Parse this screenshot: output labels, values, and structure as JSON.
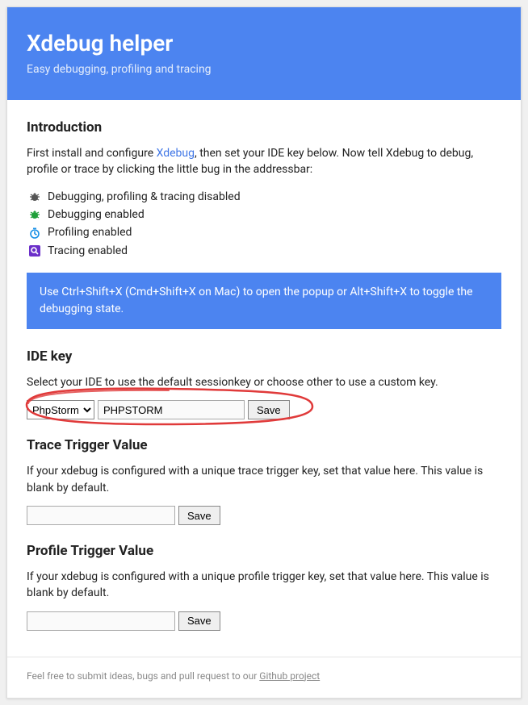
{
  "header": {
    "title": "Xdebug helper",
    "subtitle": "Easy debugging, profiling and tracing"
  },
  "intro": {
    "heading": "Introduction",
    "text_before_link": "First install and configure ",
    "link_text": "Xdebug",
    "text_after_link": ", then set your IDE key below. Now tell Xdebug to debug, profile or trace by clicking the little bug in the addressbar:"
  },
  "status_items": [
    {
      "label": "Debugging, profiling & tracing disabled",
      "icon": "bug-disabled-icon",
      "color": "#555"
    },
    {
      "label": "Debugging enabled",
      "icon": "bug-debug-icon",
      "color": "#1fa03a"
    },
    {
      "label": "Profiling enabled",
      "icon": "clock-icon",
      "color": "#178fe6"
    },
    {
      "label": "Tracing enabled",
      "icon": "search-icon",
      "color": "#6b2fc9"
    }
  ],
  "tip": "Use Ctrl+Shift+X (Cmd+Shift+X on Mac) to open the popup or Alt+Shift+X to toggle the debugging state.",
  "ide_key": {
    "heading": "IDE key",
    "description": "Select your IDE to use the default sessionkey or choose other to use a custom key.",
    "select_value": "PhpStorm",
    "input_value": "PHPSTORM",
    "save_label": "Save"
  },
  "trace_trigger": {
    "heading": "Trace Trigger Value",
    "description": "If your xdebug is configured with a unique trace trigger key, set that value here. This value is blank by default.",
    "input_value": "",
    "save_label": "Save"
  },
  "profile_trigger": {
    "heading": "Profile Trigger Value",
    "description": "If your xdebug is configured with a unique profile trigger key, set that value here. This value is blank by default.",
    "input_value": "",
    "save_label": "Save"
  },
  "footer": {
    "text": "Feel free to submit ideas, bugs and pull request to our ",
    "link_text": "Github project"
  },
  "colors": {
    "accent": "#4c84f0"
  }
}
